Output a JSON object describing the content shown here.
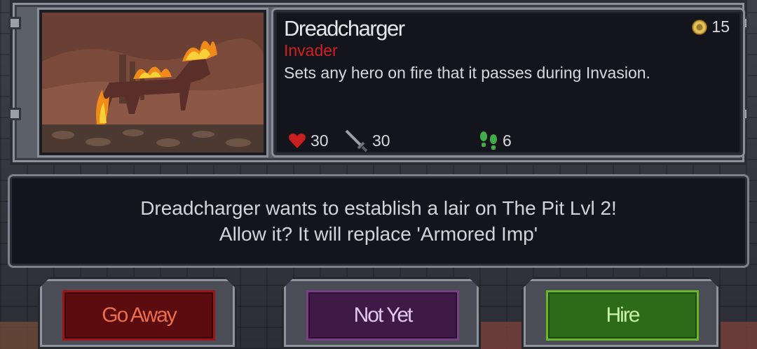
{
  "card": {
    "name": "Dreadcharger",
    "type": "Invader",
    "description": "Sets any hero on fire that it passes during Invasion.",
    "cost": "15",
    "stats": {
      "health": "30",
      "attack": "30",
      "speed": "6"
    }
  },
  "message": {
    "line1": "Dreadcharger wants to establish a lair on The Pit Lvl 2!",
    "line2": "Allow it? It will replace 'Armored Imp'"
  },
  "buttons": {
    "go_away": "Go Away",
    "not_yet": "Not Yet",
    "hire": "Hire"
  },
  "colors": {
    "type_red": "#d12020",
    "button_red": "#5c0b0e",
    "button_purple": "#3f1a47",
    "button_green": "#2e6b19"
  },
  "icons": {
    "cost": "coin-icon",
    "health": "heart-icon",
    "attack": "sword-icon",
    "speed": "footprints-icon"
  }
}
